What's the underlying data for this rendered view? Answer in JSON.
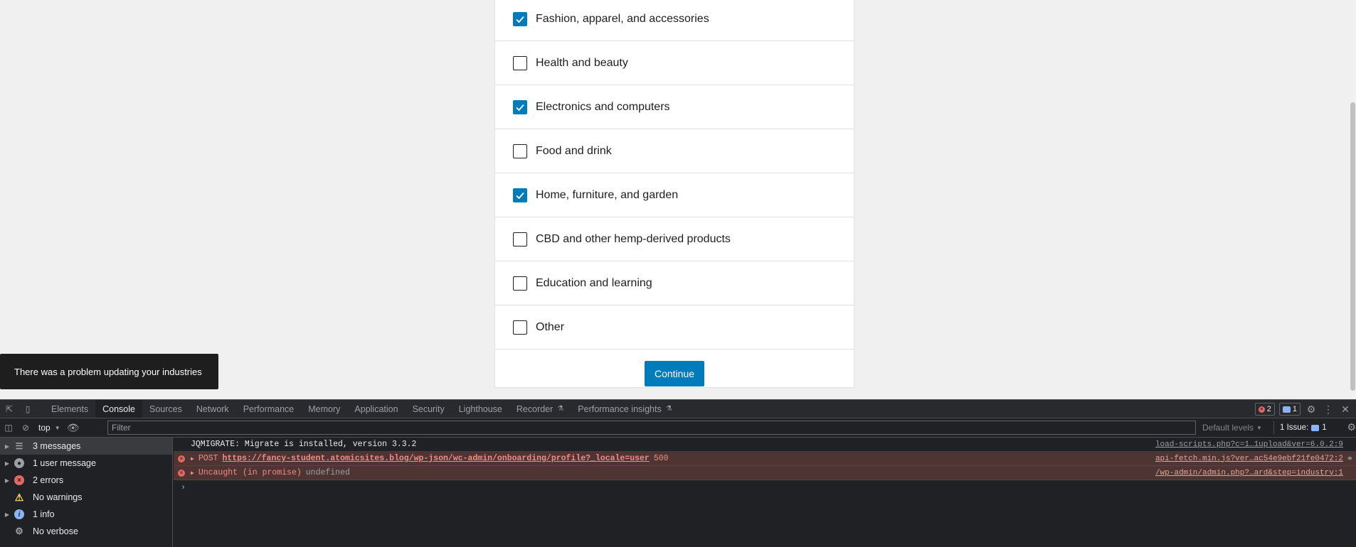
{
  "industries": [
    {
      "label": "Fashion, apparel, and accessories",
      "checked": true
    },
    {
      "label": "Health and beauty",
      "checked": false
    },
    {
      "label": "Electronics and computers",
      "checked": true
    },
    {
      "label": "Food and drink",
      "checked": false
    },
    {
      "label": "Home, furniture, and garden",
      "checked": true
    },
    {
      "label": "CBD and other hemp-derived products",
      "checked": false
    },
    {
      "label": "Education and learning",
      "checked": false
    },
    {
      "label": "Other",
      "checked": false
    }
  ],
  "continue_label": "Continue",
  "snackbar_text": "There was a problem updating your industries",
  "devtools": {
    "tabs": [
      "Elements",
      "Console",
      "Sources",
      "Network",
      "Performance",
      "Memory",
      "Application",
      "Security",
      "Lighthouse",
      "Recorder",
      "Performance insights"
    ],
    "active_tab": "Console",
    "error_badge_count": "2",
    "issue_badge_count": "1",
    "toolbar": {
      "context": "top",
      "filter_placeholder": "Filter",
      "levels_label": "Default levels",
      "issues_label": "1 Issue:",
      "issues_count": "1"
    },
    "sidebar": [
      {
        "label": "3 messages",
        "icon": "list-icon"
      },
      {
        "label": "1 user message",
        "icon": "user-icon"
      },
      {
        "label": "2 errors",
        "icon": "error-icon"
      },
      {
        "label": "No warnings",
        "icon": "warning-icon"
      },
      {
        "label": "1 info",
        "icon": "info-icon"
      },
      {
        "label": "No verbose",
        "icon": "verbose-icon"
      }
    ],
    "log": {
      "row1_text": "JQMIGRATE: Migrate is installed, version 3.3.2",
      "row1_source": "load-scripts.php?c=1…1upload&ver=6.0.2:9",
      "row2_method": "POST",
      "row2_url": "https://fancy-student.atomicsites.blog/wp-json/wc-admin/onboarding/profile?_locale=user",
      "row2_status": "500",
      "row2_source": "api-fetch.min.js?ver…ac54e9ebf21fe0472:2",
      "row3_text": "Uncaught (in promise)",
      "row3_value": "undefined",
      "row3_source": "/wp-admin/admin.php?…ard&step=industry:1"
    }
  }
}
